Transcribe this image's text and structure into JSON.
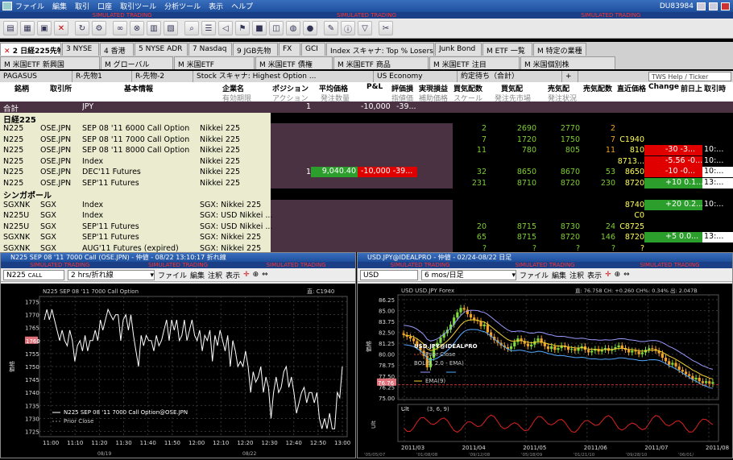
{
  "menu": {
    "items": [
      "ファイル",
      "編集",
      "取引",
      "口座",
      "取引ツール",
      "分析ツール",
      "表示",
      "ヘルプ"
    ],
    "account": "DU83984"
  },
  "simulated": "SIMULATED TRADING",
  "toolbar_icons": [
    "new-icon",
    "page-icon",
    "photo-icon",
    "close-icon",
    "refresh-icon",
    "gear-icon",
    "link-icon",
    "link2-icon",
    "book-icon",
    "book2-icon",
    "search-icon",
    "news-icon",
    "horn-icon",
    "flag-icon",
    "save-icon",
    "chart-icon",
    "globe-icon",
    "scan-icon",
    "note-icon",
    "info-icon",
    "filter-icon",
    "wrench-icon"
  ],
  "tabs_row1": [
    "2 日経225先物",
    "3 NYSE",
    "4 香港",
    "5 NYSE ADR",
    "7 Nasdaq",
    "9 JGB先物",
    "FX",
    "GCI",
    "Index スキャナ: Top % Losers",
    "Junk Bond",
    "M ETF 一覧",
    "M 特定の業種"
  ],
  "tabs_row2": [
    "M 米国ETF 新興国",
    "M グローバル",
    "M 米国ETF",
    "M 米国ETF 債権",
    "M 米国ETF 商品",
    "M 米国ETF 注目",
    "M 米国個別株"
  ],
  "pages": [
    "PAGASUS",
    "R-先物1",
    "R-先物-2",
    "Stock スキャナ: Highest Option ...",
    "US Economy",
    "約定待ち（合計）",
    "+"
  ],
  "search_placeholder": "TWS Help / Ticker Lookup",
  "headers_r1": [
    "銘柄",
    "取引所",
    "基本情報",
    "企業名",
    "ポジション",
    "平均価格",
    "P&L",
    "評価損",
    "実現損益",
    "買気配数",
    "買気配",
    "売気配",
    "売気配数",
    "直近価格",
    "Change",
    "前日上",
    "取引時"
  ],
  "headers_r2": [
    "有効期限",
    "アクション",
    "発注数量",
    "指値価",
    "補助価格",
    "スケール",
    "発注先市場",
    "発注状況"
  ],
  "total": {
    "label": "合計",
    "currency": "JPY",
    "position": "1",
    "pnl": "-10,000",
    "unrl": "-39..."
  },
  "sections": {
    "nikkei": "日経225",
    "sgx": "シンガポール"
  },
  "rows": [
    {
      "sym": "N225",
      "exch": "OSE.JPN",
      "desc": "SEP 08 '11 6000 Call Option",
      "company": "Nikkei 225",
      "pos": "",
      "avg": "",
      "pnl": "",
      "bidsz": "2",
      "bid": "2690",
      "ask": "2770",
      "asksz": "2",
      "last": "",
      "chg": "",
      "prev": "",
      "time": ""
    },
    {
      "sym": "N225",
      "exch": "OSE.JPN",
      "desc": "SEP 08 '11 7000 Call Option",
      "company": "Nikkei 225",
      "pos": "",
      "avg": "",
      "pnl": "",
      "bidsz": "7",
      "bid": "1720",
      "ask": "1750",
      "asksz": "7",
      "last": "C1940",
      "chg": "",
      "prev": "",
      "time": ""
    },
    {
      "sym": "N225",
      "exch": "OSE.JPN",
      "desc": "SEP 08 '11 8000 Call Option",
      "company": "Nikkei 225",
      "pos": "",
      "avg": "",
      "pnl": "",
      "bidsz": "11",
      "bid": "780",
      "ask": "805",
      "asksz": "11",
      "last": "810",
      "chg": "-30",
      "prev": "-3...",
      "time": "10:..."
    },
    {
      "sym": "N225",
      "exch": "OSE.JPN",
      "desc": "Index",
      "company": "Nikkei 225",
      "pos": "",
      "avg": "",
      "pnl": "",
      "bidsz": "",
      "bid": "",
      "ask": "",
      "asksz": "",
      "last": "8713...",
      "chg": "-5.56",
      "prev": "-0...",
      "time": "10:..."
    },
    {
      "sym": "N225",
      "exch": "OSE.JPN",
      "desc": "DEC'11 Futures",
      "company": "Nikkei 225",
      "pos": "1",
      "avg": "9,040.40",
      "pnl": "-10,000",
      "unrl": "-39...",
      "bidsz": "32",
      "bid": "8650",
      "ask": "8670",
      "asksz": "53",
      "last": "8650",
      "chg": "-10",
      "prev": "-0...",
      "time": "10:..."
    },
    {
      "sym": "N225",
      "exch": "OSE.JPN",
      "desc": "SEP'11 Futures",
      "company": "Nikkei 225",
      "pos": "",
      "avg": "",
      "pnl": "",
      "bidsz": "231",
      "bid": "8710",
      "ask": "8720",
      "asksz": "230",
      "last": "8720",
      "chg": "+10",
      "prev": "0.1...",
      "time": "13:..."
    },
    {
      "sym": "SGXNK",
      "exch": "SGX",
      "desc": "Index",
      "company": "SGX: Nikkei 225",
      "pos": "",
      "avg": "",
      "pnl": "",
      "bidsz": "",
      "bid": "",
      "ask": "",
      "asksz": "",
      "last": "8740",
      "chg": "+20",
      "prev": "0.2...",
      "time": "10:..."
    },
    {
      "sym": "N225U",
      "exch": "SGX",
      "desc": "Index",
      "company": "SGX: USD Nikkei ...",
      "pos": "",
      "avg": "",
      "pnl": "",
      "bidsz": "",
      "bid": "",
      "ask": "",
      "asksz": "",
      "last": "C0",
      "chg": "",
      "prev": "",
      "time": ""
    },
    {
      "sym": "N225U",
      "exch": "SGX",
      "desc": "SEP'11 Futures",
      "company": "SGX: USD Nikkei ...",
      "pos": "",
      "avg": "",
      "pnl": "",
      "bidsz": "20",
      "bid": "8715",
      "ask": "8730",
      "asksz": "24",
      "last": "C8725",
      "chg": "",
      "prev": "",
      "time": ""
    },
    {
      "sym": "SGXNK",
      "exch": "SGX",
      "desc": "SEP'11 Futures",
      "company": "SGX: Nikkei 225",
      "pos": "",
      "avg": "",
      "pnl": "",
      "bidsz": "65",
      "bid": "8715",
      "ask": "8720",
      "asksz": "146",
      "last": "8720",
      "chg": "+5",
      "prev": "0.0...",
      "time": "13:..."
    },
    {
      "sym": "SGXNK",
      "exch": "SGX",
      "desc": "AUG'11 Futures (expired)",
      "company": "SGX: Nikkei 225",
      "pos": "",
      "avg": "",
      "pnl": "",
      "bidsz": "?",
      "bid": "?",
      "ask": "?",
      "asksz": "?",
      "last": "?",
      "chg": "?",
      "prev": "",
      "time": ""
    }
  ],
  "left_chart": {
    "title": "N225 SEP 08 '11 7000 Call (OSE.JPN) - 仲値 - 08/22 13:10:17 折れ線",
    "symbol": "N225",
    "symbol_suffix": "CALL",
    "timeframe": "2 hrs/折れ線",
    "menu": [
      "ファイル",
      "編集",
      "注釈",
      "表示"
    ],
    "header": "N225 SEP 08 '11 7000 Call Option",
    "last_note": "直: C1940",
    "ylabel": "価格",
    "legend1": "N225 SEP 08 '11 7000 Call Option@OSE.JPN",
    "legend2": "Prior Close",
    "yticks": [
      "1775",
      "1770",
      "1765",
      "1760",
      "1755",
      "1750",
      "1745",
      "1740",
      "1735",
      "1730",
      "1725"
    ],
    "xticks": [
      "11:00",
      "11:10",
      "11:20",
      "11:30",
      "11:40",
      "11:50",
      "12:00",
      "12:10",
      "12:20",
      "12:30",
      "12:40",
      "12:50",
      "13:00"
    ],
    "date_marks": [
      "08/19",
      "08/22"
    ],
    "marker_price": "1760"
  },
  "right_chart": {
    "title": "USD.JPY@IDEALPRO - 仲値 - 02/24-08/22 日足",
    "symbol": "USD",
    "timeframe": "6 mos/日足",
    "menu": [
      "ファイル",
      "編集",
      "注釈",
      "表示"
    ],
    "header": "USD USD.JPY Forex",
    "stats": "直: 76.758 CH: +0.260 CH%: 0.34% 出: 2.047B",
    "ylabel": "価格",
    "yticks": [
      "86.25",
      "85.00",
      "83.75",
      "82.50",
      "81.25",
      "80.00",
      "78.75",
      "77.50",
      "76.25",
      "75.00"
    ],
    "xticks": [
      "2011/03",
      "2011/04",
      "2011/05",
      "2011/06",
      "2011/07",
      "2011/08"
    ],
    "legend_title": "USD.JPY@IDEALPRO",
    "legend_prior": "Prior Close",
    "legend_bol": "BOL(9, 2.0 - EMA)",
    "legend_ema": "EMA(9)",
    "ult_label": "Ult",
    "ult_params": "(3, 6, 9)",
    "ult_ylabel": "Ult",
    "marker_price": "76.76",
    "date_marks": [
      "'05/05/07",
      "'01/08/08",
      "'09/12/08",
      "'05/18/09",
      "'01/21/10",
      "'09/28/10",
      "'06/01/"
    ]
  }
}
